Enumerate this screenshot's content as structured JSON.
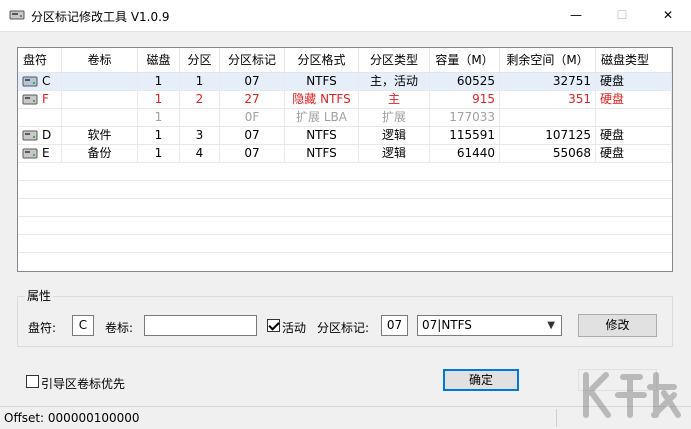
{
  "window": {
    "title": "分区标记修改工具 V1.0.9",
    "min_glyph": "—",
    "max_glyph": "☐",
    "close_glyph": "✕"
  },
  "table": {
    "columns": [
      "盘符",
      "卷标",
      "磁盘",
      "分区",
      "分区标记",
      "分区格式",
      "分区类型",
      "容量（M）",
      "剩余空间（M）",
      "磁盘类型"
    ],
    "rows": [
      {
        "drive": "C",
        "label": "",
        "disk": "1",
        "part": "1",
        "flag": "07",
        "format": "NTFS",
        "type": "主，活动",
        "cap": "60525",
        "free": "32751",
        "dtype": "硬盘",
        "style": "sel",
        "icon": true
      },
      {
        "drive": "F",
        "label": "",
        "disk": "1",
        "part": "2",
        "flag": "27",
        "format": "隐藏 NTFS",
        "type": "主",
        "cap": "915",
        "free": "351",
        "dtype": "硬盘",
        "style": "red",
        "icon": true
      },
      {
        "drive": "",
        "label": "",
        "disk": "1",
        "part": "",
        "flag": "0F",
        "format": "扩展 LBA",
        "type": "扩展",
        "cap": "177033",
        "free": "",
        "dtype": "",
        "style": "grey",
        "icon": false
      },
      {
        "drive": "D",
        "label": "软件",
        "disk": "1",
        "part": "3",
        "flag": "07",
        "format": "NTFS",
        "type": "逻辑",
        "cap": "115591",
        "free": "107125",
        "dtype": "硬盘",
        "style": "",
        "icon": true
      },
      {
        "drive": "E",
        "label": "备份",
        "disk": "1",
        "part": "4",
        "flag": "07",
        "format": "NTFS",
        "type": "逻辑",
        "cap": "61440",
        "free": "55068",
        "dtype": "硬盘",
        "style": "",
        "icon": true
      }
    ],
    "empty_rows": 5
  },
  "props": {
    "group_title": "属性",
    "drive_label": "盘符:",
    "drive_value": "C",
    "volume_label": "卷标:",
    "volume_value": "",
    "active_label": "活动",
    "active_checked": true,
    "flag_label": "分区标记:",
    "flag_value": "07",
    "flag_select_value": "07|NTFS",
    "modify_button": "修改"
  },
  "boot_priority_label": "引导区卷标优先",
  "ok_button": "确定",
  "status": {
    "offset_text": "Offset: 000000100000"
  },
  "colors": {
    "selected_row": "#e5eef9",
    "hidden_row": "#e32020",
    "extended_row": "#a0a0a0",
    "default_button_border": "#0078d7"
  }
}
